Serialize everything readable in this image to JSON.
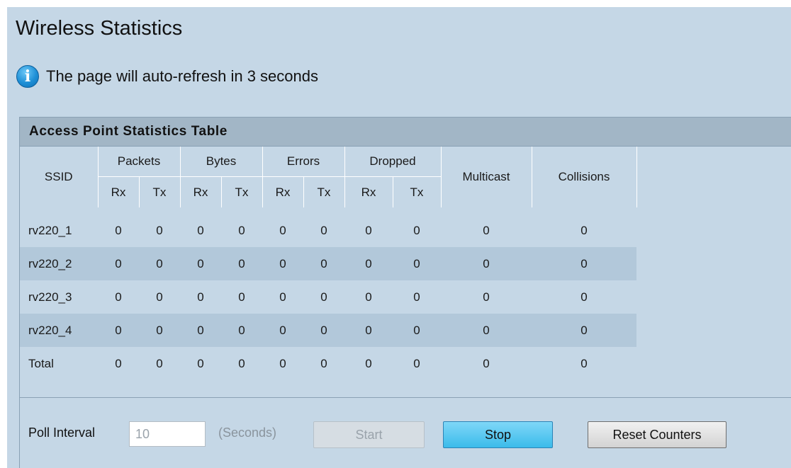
{
  "page": {
    "title": "Wireless Statistics",
    "info_message": "The page will auto-refresh in 3 seconds"
  },
  "table": {
    "title": "Access Point Statistics Table",
    "headers": {
      "ssid": "SSID",
      "packets": "Packets",
      "bytes": "Bytes",
      "errors": "Errors",
      "dropped": "Dropped",
      "multicast": "Multicast",
      "collisions": "Collisions",
      "rx": "Rx",
      "tx": "Tx"
    },
    "rows": [
      {
        "ssid": "rv220_1",
        "packets_rx": "0",
        "packets_tx": "0",
        "bytes_rx": "0",
        "bytes_tx": "0",
        "errors_rx": "0",
        "errors_tx": "0",
        "dropped_rx": "0",
        "dropped_tx": "0",
        "multicast": "0",
        "collisions": "0"
      },
      {
        "ssid": "rv220_2",
        "packets_rx": "0",
        "packets_tx": "0",
        "bytes_rx": "0",
        "bytes_tx": "0",
        "errors_rx": "0",
        "errors_tx": "0",
        "dropped_rx": "0",
        "dropped_tx": "0",
        "multicast": "0",
        "collisions": "0"
      },
      {
        "ssid": "rv220_3",
        "packets_rx": "0",
        "packets_tx": "0",
        "bytes_rx": "0",
        "bytes_tx": "0",
        "errors_rx": "0",
        "errors_tx": "0",
        "dropped_rx": "0",
        "dropped_tx": "0",
        "multicast": "0",
        "collisions": "0"
      },
      {
        "ssid": "rv220_4",
        "packets_rx": "0",
        "packets_tx": "0",
        "bytes_rx": "0",
        "bytes_tx": "0",
        "errors_rx": "0",
        "errors_tx": "0",
        "dropped_rx": "0",
        "dropped_tx": "0",
        "multicast": "0",
        "collisions": "0"
      },
      {
        "ssid": "Total",
        "packets_rx": "0",
        "packets_tx": "0",
        "bytes_rx": "0",
        "bytes_tx": "0",
        "errors_rx": "0",
        "errors_tx": "0",
        "dropped_rx": "0",
        "dropped_tx": "0",
        "multicast": "0",
        "collisions": "0"
      }
    ]
  },
  "footer": {
    "poll_label": "Poll Interval",
    "poll_value": "10",
    "seconds_label": "(Seconds)",
    "start_label": "Start",
    "stop_label": "Stop",
    "reset_label": "Reset Counters"
  },
  "icons": {
    "info": "info-icon"
  },
  "colors": {
    "panel_bg": "#c5d7e6",
    "table_title_bg": "#a2b6c6",
    "row_alt_bg": "#b2c8da",
    "stop_button": "#3bbbea"
  }
}
